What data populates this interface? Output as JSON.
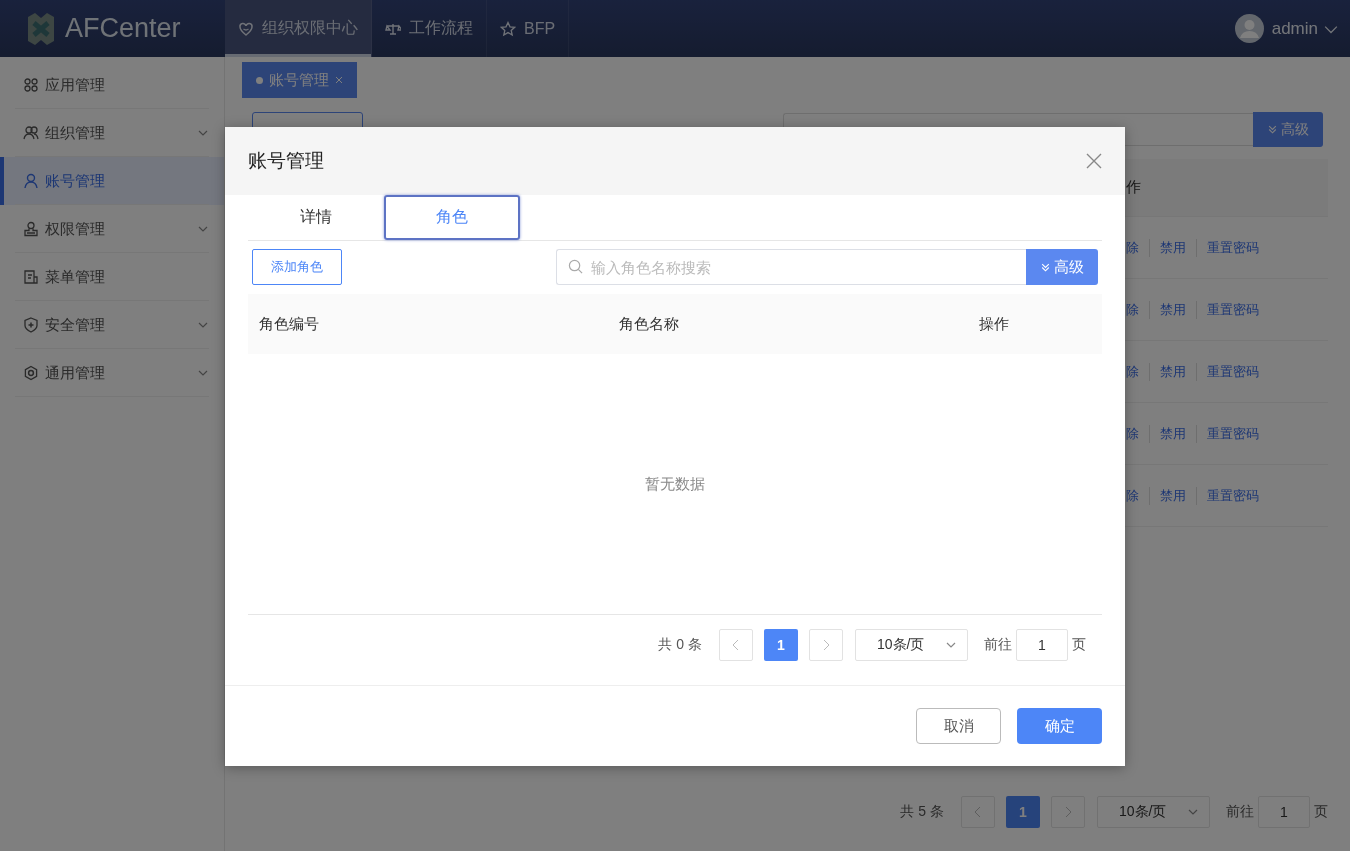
{
  "header": {
    "logo_text": "AFCenter",
    "nav": [
      {
        "label": "组织权限中心",
        "selected": true
      },
      {
        "label": "工作流程",
        "selected": false
      },
      {
        "label": "BFP",
        "selected": false
      }
    ],
    "user": {
      "name": "admin"
    }
  },
  "sidebar": {
    "items": [
      {
        "label": "应用管理",
        "selected": false,
        "expandable": false
      },
      {
        "label": "组织管理",
        "selected": false,
        "expandable": true
      },
      {
        "label": "账号管理",
        "selected": true,
        "expandable": false
      },
      {
        "label": "权限管理",
        "selected": false,
        "expandable": true
      },
      {
        "label": "菜单管理",
        "selected": false,
        "expandable": false
      },
      {
        "label": "安全管理",
        "selected": false,
        "expandable": true
      },
      {
        "label": "通用管理",
        "selected": false,
        "expandable": true
      }
    ]
  },
  "page_tabs": [
    {
      "label": "账号管理",
      "selected": true
    }
  ],
  "background": {
    "advanced_button": "高级",
    "table": {
      "column_header": "作",
      "rows": [
        {
          "actions": [
            "除",
            "禁用",
            "重置密码"
          ]
        },
        {
          "actions": [
            "除",
            "禁用",
            "重置密码"
          ]
        },
        {
          "actions": [
            "除",
            "禁用",
            "重置密码"
          ]
        },
        {
          "actions": [
            "除",
            "禁用",
            "重置密码"
          ]
        },
        {
          "actions": [
            "除",
            "禁用",
            "重置密码"
          ]
        }
      ]
    },
    "pagination": {
      "total": "共 5 条",
      "current_page": "1",
      "page_size": "10条/页",
      "goto_label": "前往",
      "goto_value": "1",
      "page_suffix": "页"
    }
  },
  "modal": {
    "title": "账号管理",
    "tabs": [
      {
        "label": "详情",
        "selected": false
      },
      {
        "label": "角色",
        "selected": true
      }
    ],
    "add_button": "添加角色",
    "search": {
      "placeholder": "输入角色名称搜索"
    },
    "advanced_button": "高级",
    "table": {
      "columns": [
        "角色编号",
        "角色名称",
        "操作"
      ],
      "empty_text": "暂无数据"
    },
    "pagination": {
      "total": "共 0 条",
      "current_page": "1",
      "page_size": "10条/页",
      "goto_label": "前往",
      "goto_value": "1",
      "page_suffix": "页"
    },
    "buttons": [
      {
        "label": "取消",
        "kind": "default"
      },
      {
        "label": "确定",
        "kind": "primary"
      }
    ]
  }
}
